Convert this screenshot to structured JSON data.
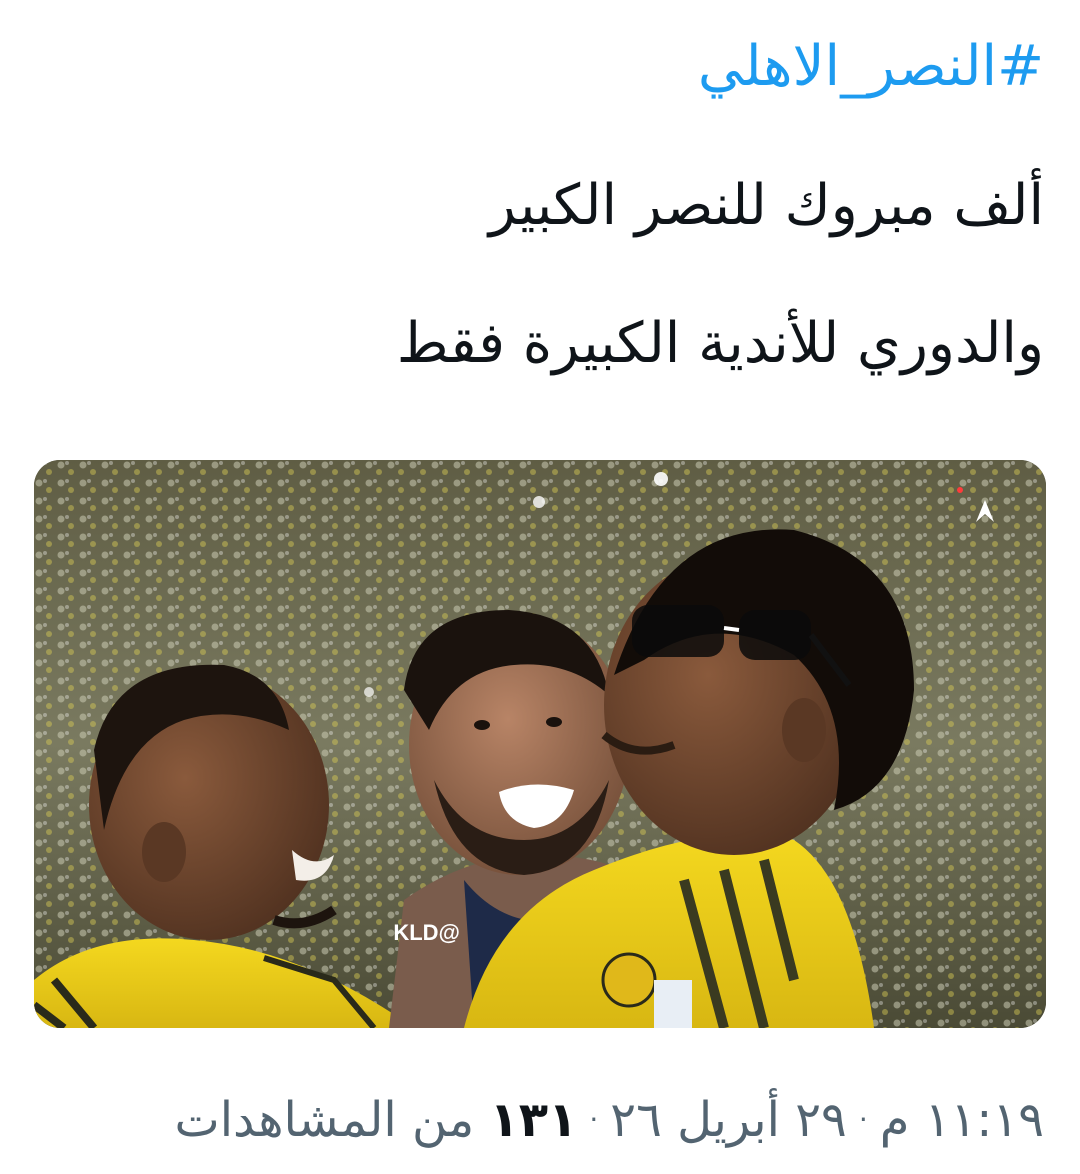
{
  "tweet": {
    "hashtag": "#النصر_الاهلي",
    "text_line_1": "ألف مبروك للنصر الكبير",
    "text_line_2": "والدوري للأندية الكبيرة فقط",
    "media": {
      "watermark": "@KLD",
      "alt_subject": "three football players celebrating in a stadium"
    },
    "meta": {
      "time": "١١:١٩ م",
      "date": "٢٩ أبريل ٢٦",
      "views_count": "١٣١",
      "views_label": "من المشاهدات",
      "separator": "·"
    }
  },
  "colors": {
    "link": "#1d9bf0",
    "text": "#0f1419",
    "secondary": "#536471",
    "jersey_yellow": "#f2d41f",
    "background": "#ffffff"
  }
}
